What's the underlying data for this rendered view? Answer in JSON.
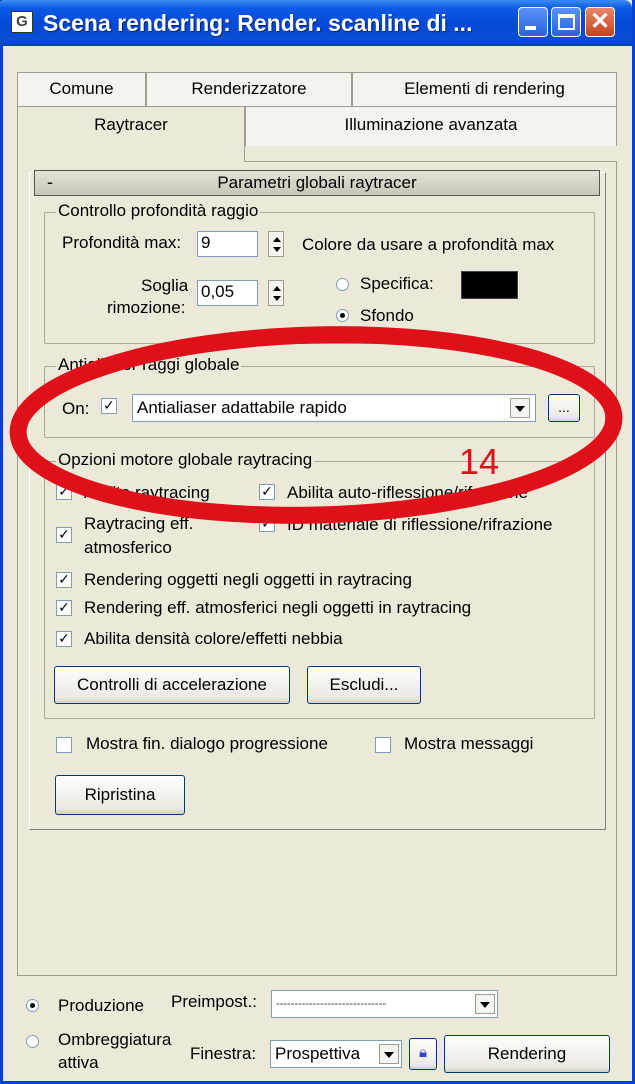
{
  "window": {
    "title": "Scena rendering: Render. scanline di ...",
    "icon_letter": "G"
  },
  "tabs": {
    "row1": [
      "Comune",
      "Renderizzatore",
      "Elementi di rendering"
    ],
    "row2": [
      "Raytracer",
      "Illuminazione avanzata"
    ],
    "active": "Raytracer"
  },
  "rollout": {
    "toggle": "-",
    "title": "Parametri globali raytracer"
  },
  "depth": {
    "group_label": "Controllo profondità raggio",
    "max_label": "Profondità max:",
    "max_value": "9",
    "color_label": "Colore da usare a profondità max",
    "threshold_label_1": "Soglia",
    "threshold_label_2": "rimozione:",
    "threshold_value": "0,05",
    "specify_label": "Specifica:",
    "background_label": "Sfondo",
    "color_value": "#000000"
  },
  "antialias": {
    "group_label": "Antialiaser raggi globale",
    "on_label": "On:",
    "on_checked": true,
    "selected": "Antialiaser adattabile rapido",
    "browse_label": "..."
  },
  "engine": {
    "group_label": "Opzioni motore globale raytracing",
    "options": [
      {
        "label": "Abilita raytracing",
        "checked": true
      },
      {
        "label": "Abilita auto-riflessione/rifrazione",
        "checked": true
      },
      {
        "label": "Raytracing eff.",
        "label2": "atmosferico",
        "checked": true
      },
      {
        "label": "ID materiale di riflessione/rifrazione",
        "checked": true
      },
      {
        "label": "Rendering oggetti negli oggetti in raytracing",
        "checked": true
      },
      {
        "label": "Rendering eff. atmosferici negli oggetti in raytracing",
        "checked": true
      },
      {
        "label": "Abilita densità colore/effetti nebbia",
        "checked": true
      }
    ],
    "accel_button": "Controlli di accelerazione",
    "exclude_button": "Escludi..."
  },
  "misc": {
    "progress_label": "Mostra fin. dialogo progressione",
    "progress_checked": false,
    "messages_label": "Mostra messaggi",
    "messages_checked": false,
    "reset_button": "Ripristina"
  },
  "footer": {
    "production_label": "Produzione",
    "activeshade_label_1": "Ombreggiatura",
    "activeshade_label_2": "attiva",
    "preset_label": "Preimpost.:",
    "preset_value": "------------------------------",
    "viewport_label": "Finestra:",
    "viewport_value": "Prospettiva",
    "render_button": "Rendering"
  },
  "annotation": {
    "number": "14",
    "color": "#e0101a"
  }
}
